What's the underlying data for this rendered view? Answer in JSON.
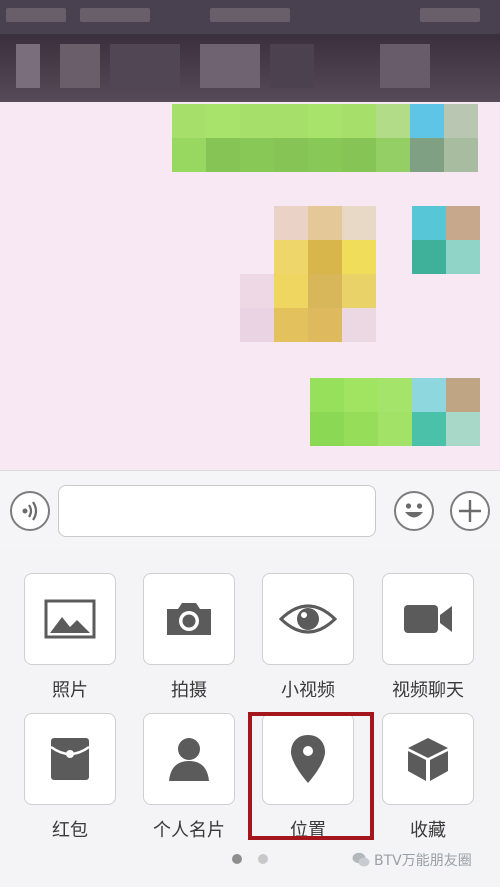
{
  "panel": {
    "items": [
      {
        "label": "照片",
        "icon": "photo-icon"
      },
      {
        "label": "拍摄",
        "icon": "camera-icon"
      },
      {
        "label": "小视频",
        "icon": "eye-icon"
      },
      {
        "label": "视频聊天",
        "icon": "video-camera-icon"
      },
      {
        "label": "红包",
        "icon": "red-packet-icon"
      },
      {
        "label": "个人名片",
        "icon": "contact-card-icon"
      },
      {
        "label": "位置",
        "icon": "location-pin-icon"
      },
      {
        "label": "收藏",
        "icon": "favorites-box-icon"
      }
    ],
    "page_indicator": {
      "pages": 2,
      "current": 1
    }
  },
  "watermark": {
    "text": "BTV万能朋友圈"
  },
  "colors": {
    "highlight": "#a5161c",
    "icon": "#5b5b5b",
    "chat_bg": "#f8e8f3"
  }
}
